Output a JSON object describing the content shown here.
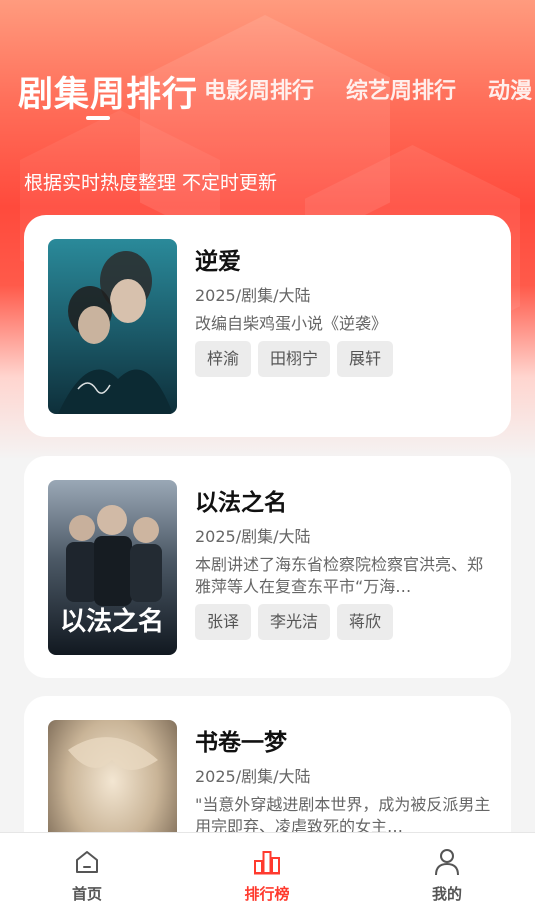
{
  "tabs": [
    {
      "label": "剧集周排行",
      "active": true
    },
    {
      "label": "电影周排行",
      "active": false
    },
    {
      "label": "综艺周排行",
      "active": false
    },
    {
      "label": "动漫",
      "active": false
    }
  ],
  "subtitle": "根据实时热度整理 不定时更新",
  "items": [
    {
      "title": "逆爱",
      "meta": "2025/剧集/大陆",
      "description": "改编自柴鸡蛋小说《逆袭》",
      "tags": [
        "梓渝",
        "田栩宁",
        "展轩"
      ]
    },
    {
      "title": "以法之名",
      "meta": "2025/剧集/大陆",
      "description": "本剧讲述了海东省检察院检察官洪亮、郑雅萍等人在复查东平市“万海…",
      "tags": [
        "张译",
        "李光洁",
        "蒋欣"
      ]
    },
    {
      "title": "书卷一梦",
      "meta": "2025/剧集/大陆",
      "description": "\"当意外穿越进剧本世界，成为被反派男主用完即弃、凌虐致死的女主…",
      "tags": []
    }
  ],
  "nav": [
    {
      "label": "首页",
      "icon": "home-icon",
      "active": false
    },
    {
      "label": "排行榜",
      "icon": "ranking-chart-icon",
      "active": true
    },
    {
      "label": "我的",
      "icon": "user-profile-icon",
      "active": false
    }
  ],
  "colors": {
    "accent": "#ff3a2e",
    "header_gradient_top": "#ff9b7e",
    "header_gradient_mid": "#ff4a3c",
    "page_background": "#f4f4f4"
  }
}
